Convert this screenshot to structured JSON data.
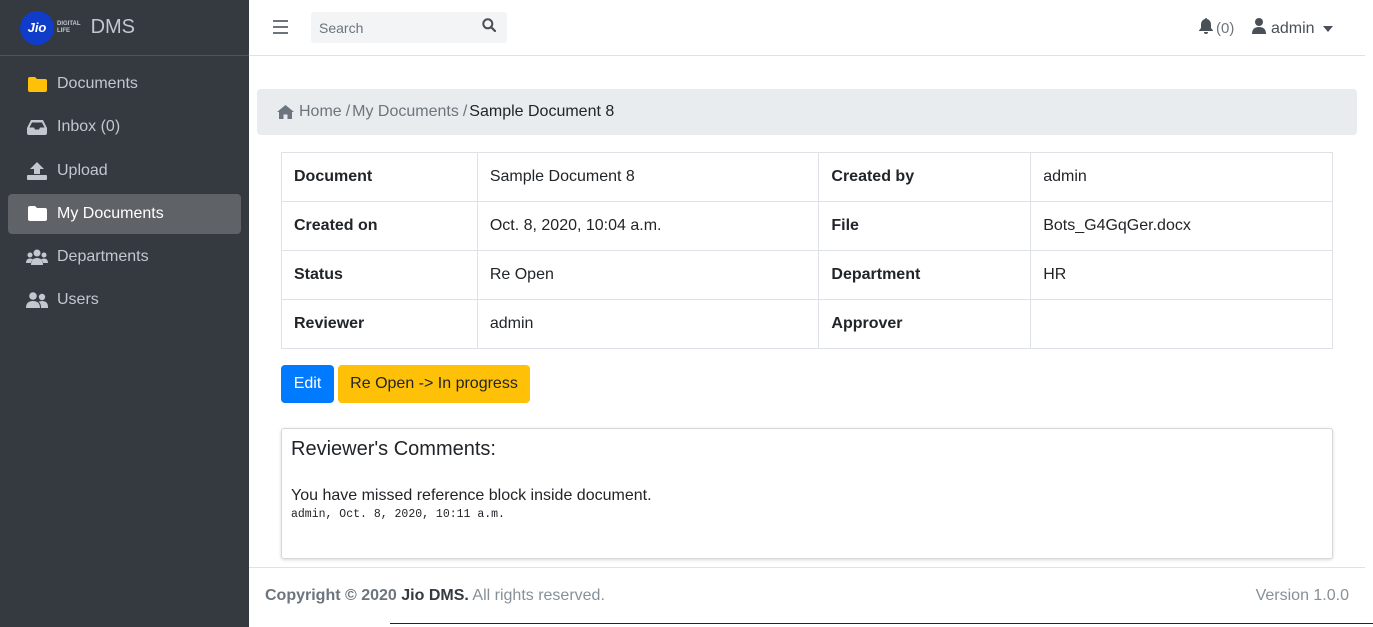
{
  "brand": {
    "logo_text": "Jio",
    "logo_sub_1": "DIGITAL",
    "logo_sub_2": "LIFE",
    "name": "DMS"
  },
  "sidebar": {
    "items": [
      {
        "label": "Documents",
        "icon": "folder-icon",
        "icon_color": "#ffc107",
        "active": false
      },
      {
        "label": "Inbox (0)",
        "icon": "inbox-icon",
        "active": false
      },
      {
        "label": "Upload",
        "icon": "upload-icon",
        "active": false
      },
      {
        "label": "My Documents",
        "icon": "folder-open-icon",
        "active": true
      },
      {
        "label": "Departments",
        "icon": "users-group-icon",
        "active": false
      },
      {
        "label": "Users",
        "icon": "users-icon",
        "active": false
      }
    ]
  },
  "navbar": {
    "search_placeholder": "Search",
    "notification_count": "(0)",
    "user_label": "admin"
  },
  "breadcrumb": {
    "home": "Home",
    "sep1": "/",
    "parent": "My Documents",
    "sep2": "/",
    "current": "Sample Document 8"
  },
  "details": {
    "rows": [
      {
        "l1": "Document",
        "v1": "Sample Document 8",
        "l2": "Created by",
        "v2": "admin"
      },
      {
        "l1": "Created on",
        "v1": "Oct. 8, 2020, 10:04 a.m.",
        "l2": "File",
        "v2": "Bots_G4GqGer.docx"
      },
      {
        "l1": "Status",
        "v1": "Re Open",
        "l2": "Department",
        "v2": "HR"
      },
      {
        "l1": "Reviewer",
        "v1": "admin",
        "l2": "Approver",
        "v2": ""
      }
    ]
  },
  "actions": {
    "edit_label": "Edit",
    "status_label": "Re Open -> In progress"
  },
  "comments": {
    "title": "Reviewer's Comments:",
    "text": "You have missed reference block inside document.",
    "meta": "admin, Oct. 8, 2020, 10:11 a.m."
  },
  "footer": {
    "copyright": "Copyright © 2020",
    "brand": "Jio DMS.",
    "rights": "All rights reserved.",
    "version": "Version 1.0.0"
  },
  "colors": {
    "sidebar_bg": "#343a40",
    "primary": "#007bff",
    "warning": "#ffc107"
  }
}
